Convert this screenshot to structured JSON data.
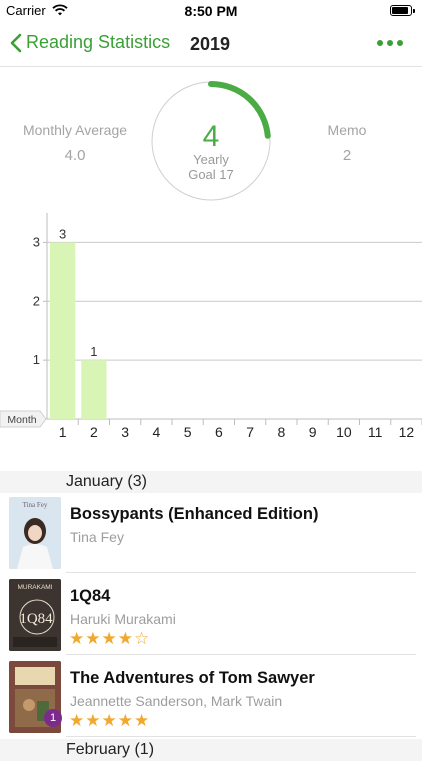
{
  "status_bar": {
    "carrier": "Carrier",
    "time": "8:50 PM",
    "battery_level": 0.9
  },
  "nav": {
    "back_label": "Reading Statistics",
    "year": "2019",
    "back_icon": "chevron-left-icon",
    "more_icon": "ellipsis-icon"
  },
  "summary": {
    "monthly_average_label": "Monthly Average",
    "monthly_average_value": "4.0",
    "memo_label": "Memo",
    "memo_value": "2",
    "yearly_count": "4",
    "yearly_label": "Yearly",
    "goal_label": "Goal 17",
    "goal_progress": 0.235,
    "accent_color": "#4bab45"
  },
  "chart_data": {
    "type": "bar",
    "categories": [
      "1",
      "2",
      "3",
      "4",
      "5",
      "6",
      "7",
      "8",
      "9",
      "10",
      "11",
      "12"
    ],
    "values": [
      3,
      1,
      0,
      0,
      0,
      0,
      0,
      0,
      0,
      0,
      0,
      0
    ],
    "data_labels": [
      "3",
      "1",
      "",
      "",
      "",
      "",
      "",
      "",
      "",
      "",
      "",
      ""
    ],
    "y_ticks": [
      "1",
      "2",
      "3"
    ],
    "ylim": [
      0,
      3.5
    ],
    "xlabel": "Month",
    "bar_color": "#d9f5b6",
    "grid": true
  },
  "sections": [
    {
      "title": "January (3)",
      "books": [
        {
          "title": "Bossypants (Enhanced Edition)",
          "author": "Tina Fey",
          "stars": "",
          "cover_text": "Tina Fey",
          "cover_color": "#dfe9f2",
          "badge": ""
        },
        {
          "title": "1Q84",
          "author": "Haruki Murakami",
          "stars": "★★★★☆",
          "cover_text": "MURAKAMI",
          "cover_color": "#3b3430",
          "badge": ""
        },
        {
          "title": "The Adventures of Tom Sawyer",
          "author": "Jeannette Sanderson, Mark Twain",
          "stars": "★★★★★",
          "cover_text": "",
          "cover_color": "#7b4a3c",
          "badge": "1"
        }
      ]
    },
    {
      "title": "February (1)",
      "books": []
    }
  ]
}
